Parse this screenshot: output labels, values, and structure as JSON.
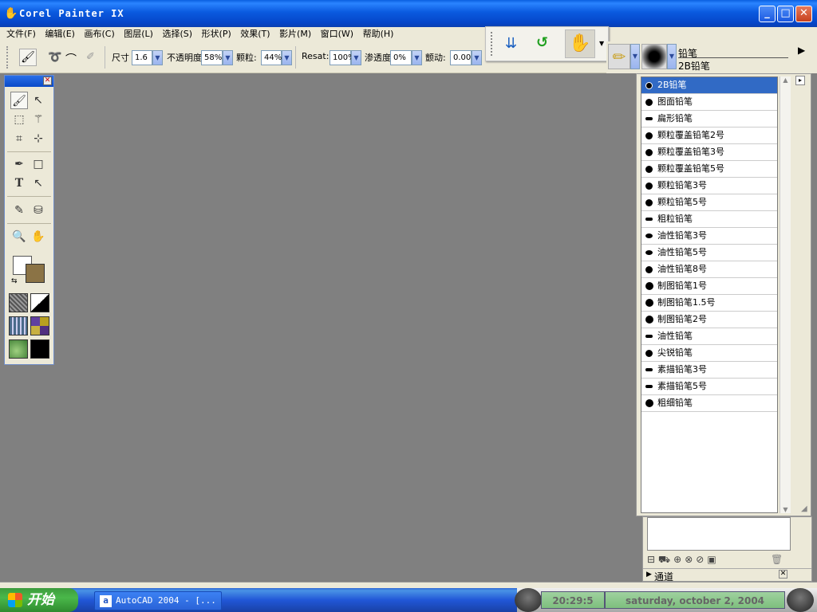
{
  "window": {
    "title": "Corel Painter IX"
  },
  "menu": [
    "文件(F)",
    "编辑(E)",
    "画布(C)",
    "图层(L)",
    "选择(S)",
    "形状(P)",
    "效果(T)",
    "影片(M)",
    "窗口(W)",
    "帮助(H)"
  ],
  "propbar": {
    "size_label": "尺寸",
    "size_value": "1.6",
    "opacity_label": "不透明度",
    "opacity_value": "58%",
    "grain_label": "颗粒:",
    "grain_value": "44%",
    "resat_label": "Resat:",
    "resat_value": "100%",
    "bleed_label": "渗透度",
    "bleed_value": "0%",
    "jitter_label": "颤动:",
    "jitter_value": "0.00"
  },
  "brush_selector": {
    "category": "铅笔",
    "variant": "2B铅笔"
  },
  "brush_list": [
    "2B铅笔",
    "图面铅笔",
    "扁形铅笔",
    "颗粒覆盖铅笔2号",
    "颗粒覆盖铅笔3号",
    "颗粒覆盖铅笔5号",
    "颗粒铅笔3号",
    "颗粒铅笔5号",
    "粗粒铅笔",
    "油性铅笔3号",
    "油性铅笔5号",
    "油性铅笔8号",
    "制图铅笔1号",
    "制图铅笔1.5号",
    "制图铅笔2号",
    "油性铅笔",
    "尖锐铅笔",
    "素描铅笔3号",
    "素描铅笔5号",
    "粗细铅笔"
  ],
  "selected_brush": "2B铅笔",
  "channels_panel": {
    "title": "通道"
  },
  "taskbar": {
    "start": "开始",
    "task": "AutoCAD 2004 - [...",
    "time": "20:29:5",
    "date": "saturday, october 2, 2004"
  },
  "colors": {
    "primary": "#ffffff",
    "secondary": "#8b7345",
    "canvas": "#808080"
  }
}
